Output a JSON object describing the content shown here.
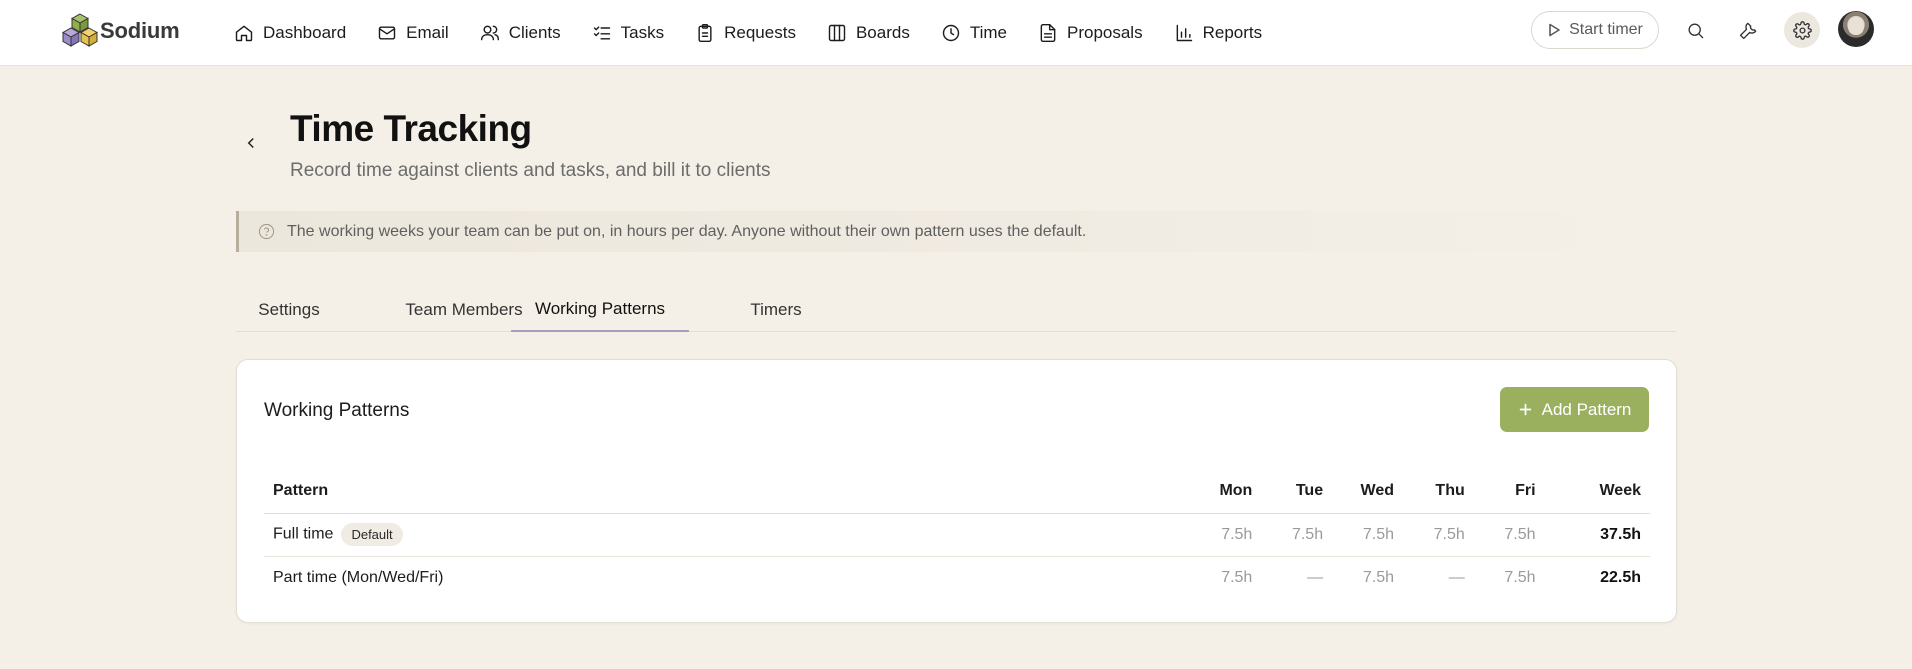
{
  "brand": {
    "name": "Sodium"
  },
  "nav": {
    "items": [
      {
        "label": "Dashboard",
        "icon": "home-icon"
      },
      {
        "label": "Email",
        "icon": "mail-icon"
      },
      {
        "label": "Clients",
        "icon": "users-icon"
      },
      {
        "label": "Tasks",
        "icon": "checklist-icon"
      },
      {
        "label": "Requests",
        "icon": "clipboard-icon"
      },
      {
        "label": "Boards",
        "icon": "columns-icon"
      },
      {
        "label": "Time",
        "icon": "clock-icon"
      },
      {
        "label": "Proposals",
        "icon": "document-icon"
      },
      {
        "label": "Reports",
        "icon": "bar-chart-icon"
      }
    ]
  },
  "toolbar": {
    "start_timer_label": "Start timer"
  },
  "header": {
    "title": "Time Tracking",
    "subtitle": "Record time against clients and tasks, and bill it to clients"
  },
  "info": {
    "text": "The working weeks your team can be put on, in hours per day. Anyone without their own pattern uses the default."
  },
  "tabs": [
    {
      "label": "Settings",
      "active": false
    },
    {
      "label": "Team Members",
      "active": false
    },
    {
      "label": "Working Patterns",
      "active": true
    },
    {
      "label": "Timers",
      "active": false
    }
  ],
  "card": {
    "title": "Working Patterns",
    "add_label": "Add Pattern",
    "columns": [
      "Pattern",
      "Mon",
      "Tue",
      "Wed",
      "Thu",
      "Fri",
      "Week"
    ],
    "rows": [
      {
        "name": "Full time",
        "badge": "Default",
        "mon": "7.5h",
        "tue": "7.5h",
        "wed": "7.5h",
        "thu": "7.5h",
        "fri": "7.5h",
        "week": "37.5h"
      },
      {
        "name": "Part time (Mon/Wed/Fri)",
        "badge": "",
        "mon": "7.5h",
        "tue": "—",
        "wed": "7.5h",
        "thu": "—",
        "fri": "7.5h",
        "week": "22.5h"
      }
    ]
  },
  "colors": {
    "accent": "#9bb05f",
    "tab_underline": "#a89bc4",
    "page_bg": "#f4f0e8"
  }
}
